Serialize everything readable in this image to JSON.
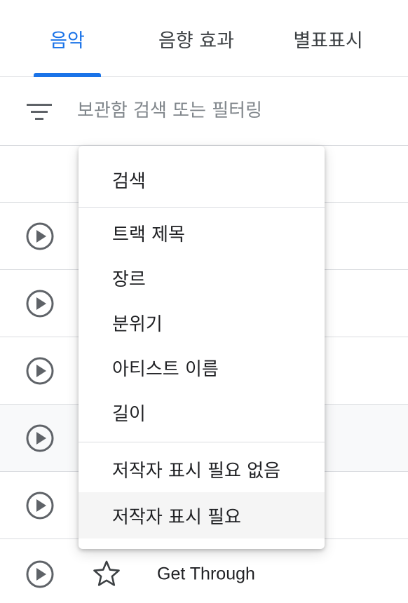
{
  "tabs": {
    "items": [
      {
        "label": "음악",
        "active": true
      },
      {
        "label": "음향 효과",
        "active": false
      },
      {
        "label": "별표표시",
        "active": false
      }
    ],
    "accent_color": "#1a73e8"
  },
  "search": {
    "placeholder": "보관함 검색 또는 필터링",
    "value": "",
    "filter_icon": "filter-list-icon"
  },
  "filter_menu": {
    "groups": [
      {
        "items": [
          "검색"
        ]
      },
      {
        "items": [
          "트랙 제목",
          "장르",
          "분위기",
          "아티스트 이름",
          "길이"
        ]
      },
      {
        "items": [
          "저작자 표시 필요 없음",
          "저작자 표시 필요"
        ],
        "hovered": "저작자 표시 필요"
      }
    ]
  },
  "tracks": [
    {
      "title": "",
      "starred": false
    },
    {
      "title": "",
      "starred": false
    },
    {
      "title": "",
      "starred": false
    },
    {
      "title": "",
      "starred": false
    },
    {
      "title": "",
      "starred": false
    },
    {
      "title": "Get Through",
      "starred": false
    }
  ]
}
